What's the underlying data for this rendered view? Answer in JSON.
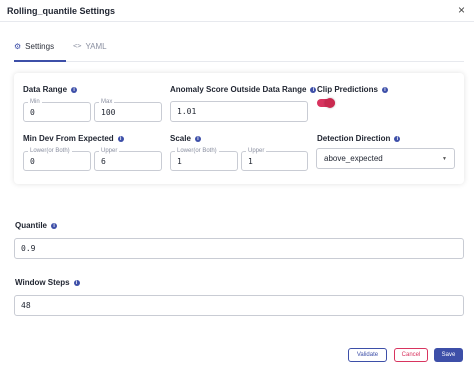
{
  "dialog": {
    "title": "Rolling_quantile Settings",
    "close_glyph": "×"
  },
  "tabs": [
    {
      "label": "Settings",
      "icon": "gear-icon",
      "glyph": "⚙"
    },
    {
      "label": "YAML",
      "icon": "code-icon",
      "glyph": "<>"
    }
  ],
  "info_glyph": "i",
  "data_range": {
    "label": "Data Range",
    "min_legend": "Min",
    "min_value": "0",
    "max_legend": "Max",
    "max_value": "100"
  },
  "anomaly_score": {
    "label": "Anomaly Score Outside Data Range",
    "value": "1.01"
  },
  "clip_predictions": {
    "label": "Clip Predictions",
    "enabled": true
  },
  "min_dev": {
    "label": "Min Dev From Expected",
    "lower_legend": "Lower(or Both)",
    "lower_value": "0",
    "upper_legend": "Upper",
    "upper_value": "6"
  },
  "scale": {
    "label": "Scale",
    "lower_legend": "Lower(or Both)",
    "lower_value": "1",
    "upper_legend": "Upper",
    "upper_value": "1"
  },
  "detection_direction": {
    "label": "Detection Direction",
    "value": "above_expected",
    "caret": "▼"
  },
  "quantile": {
    "label": "Quantile",
    "value": "0.9"
  },
  "window_steps": {
    "label": "Window Steps",
    "value": "48"
  },
  "buttons": {
    "validate": "Validate",
    "cancel": "Cancel",
    "save": "Save"
  },
  "colors": {
    "accent": "#3d4fa8",
    "danger": "#d8345f"
  }
}
